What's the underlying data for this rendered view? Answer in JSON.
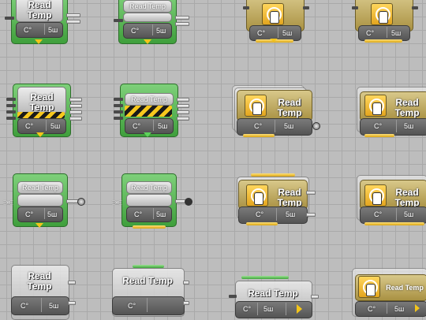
{
  "blocks": {
    "read_temp_label": "Read Temp",
    "read_temp_bold": [
      "Read",
      "Temp"
    ],
    "unit_label": "C°",
    "port_label": "5ш"
  },
  "colors": {
    "grid_bg": "#bdbdbd",
    "nxt_green": "#4caf50",
    "touch_yellow": "#f0b428",
    "stripe_yellow": "#f7c81d"
  },
  "icons": [
    "touch-sensor-icon",
    "hazard-stripe-icon",
    "output-arrow-icon",
    "input-fork-icon",
    "play-triangle-icon"
  ]
}
